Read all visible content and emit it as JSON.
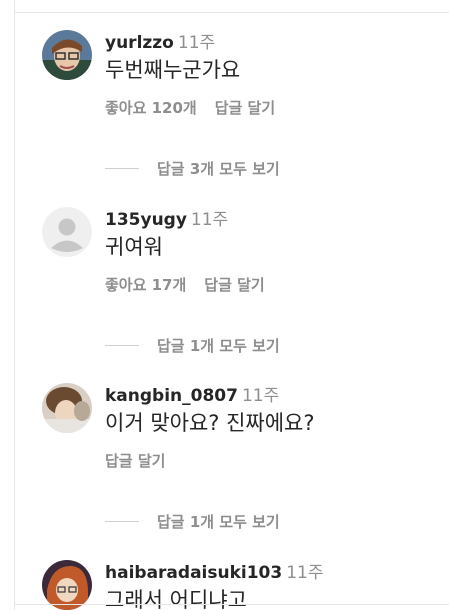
{
  "comments": [
    {
      "username": "yurlzzo",
      "time": "11주",
      "text": "두번째누군가요",
      "likes": "좋아요 120개",
      "reply": "답글 달기",
      "view_replies": "답글 3개 모두 보기"
    },
    {
      "username": "135yugy",
      "time": "11주",
      "text": "귀여워",
      "likes": "좋아요 17개",
      "reply": "답글 달기",
      "view_replies": "답글 1개 모두 보기"
    },
    {
      "username": "kangbin_0807",
      "time": "11주",
      "text": "이거 맞아요? 진짜에요?",
      "likes": "",
      "reply": "답글 달기",
      "view_replies": "답글 1개 모두 보기"
    },
    {
      "username": "haibaradaisuki103",
      "time": "11주",
      "text": "그래서 어디냐고",
      "likes": "",
      "reply": "",
      "view_replies": ""
    }
  ],
  "colors": {
    "text": "#262626",
    "secondary": "#8e8e8e",
    "divider": "#e6e6e6",
    "avatar_default": "#dbdbdb"
  }
}
